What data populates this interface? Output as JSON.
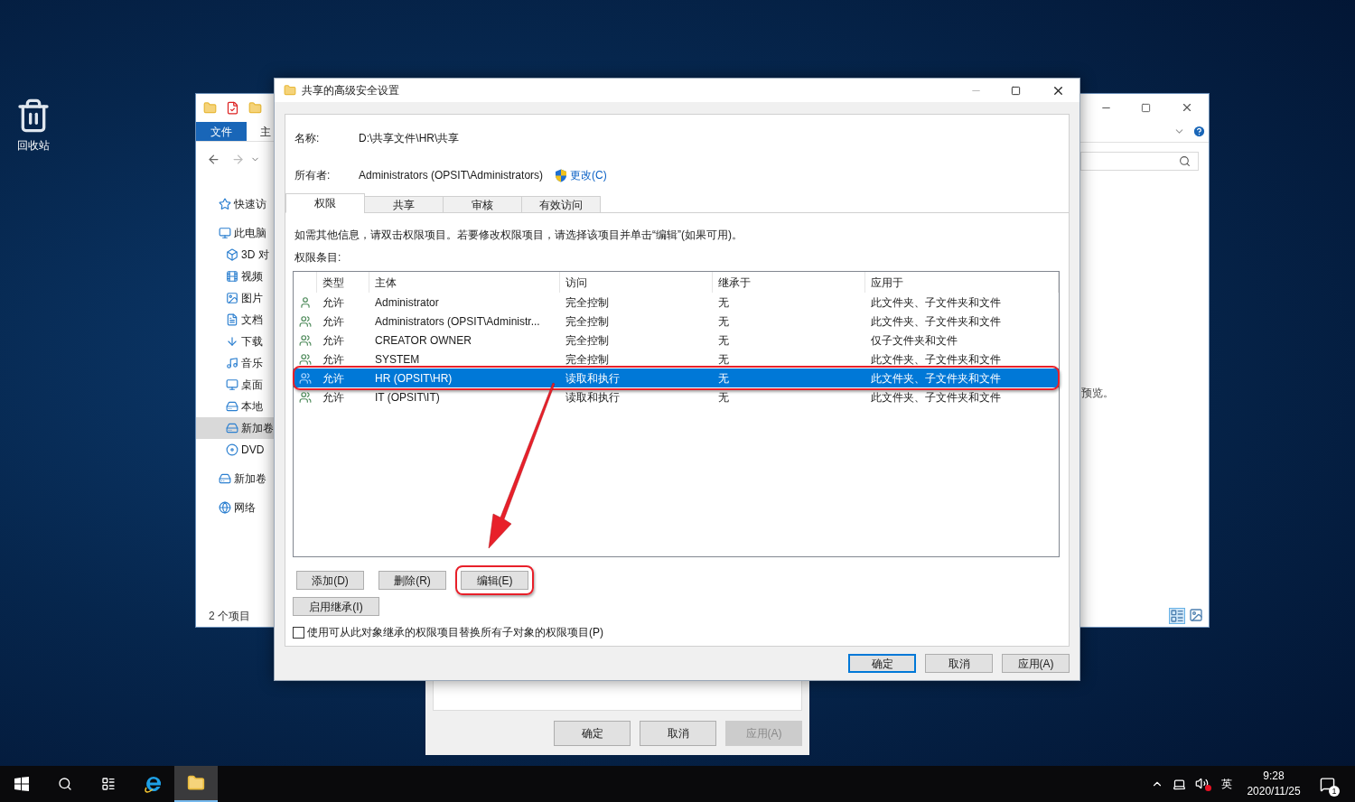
{
  "desktop": {
    "icons": [
      {
        "label": "回收站"
      }
    ]
  },
  "explorer": {
    "ribbon_tabs": [
      {
        "label": "文件",
        "selected": true
      },
      {
        "label": "主",
        "selected": false
      }
    ],
    "nav_items": [
      {
        "label": "快速访",
        "selected": false
      },
      {
        "label": "此电脑",
        "selected": false,
        "children": [
          {
            "label": "3D 对",
            "selected": false
          },
          {
            "label": "视频",
            "selected": false
          },
          {
            "label": "图片",
            "selected": false
          },
          {
            "label": "文档",
            "selected": false
          },
          {
            "label": "下载",
            "selected": false
          },
          {
            "label": "音乐",
            "selected": false
          },
          {
            "label": "桌面",
            "selected": false
          },
          {
            "label": "本地",
            "selected": false
          },
          {
            "label": "新加卷",
            "selected": true
          },
          {
            "label": "DVD",
            "selected": false
          }
        ]
      },
      {
        "label": "新加卷",
        "selected": false
      },
      {
        "label": "网络",
        "selected": false
      }
    ],
    "status": "2 个项目",
    "preview_text": "预览。"
  },
  "back_dialog": {
    "buttons": [
      {
        "label": "确定",
        "disabled": false
      },
      {
        "label": "取消",
        "disabled": false
      },
      {
        "label": "应用(A)",
        "disabled": true
      }
    ]
  },
  "dialog": {
    "title": "共享的高级安全设置",
    "name_label": "名称:",
    "name_value": "D:\\共享文件\\HR\\共享",
    "owner_label": "所有者:",
    "owner_value": "Administrators (OPSIT\\Administrators)",
    "change_link": "更改(C)",
    "tabs": [
      {
        "label": "权限",
        "selected": true
      },
      {
        "label": "共享",
        "selected": false
      },
      {
        "label": "审核",
        "selected": false
      },
      {
        "label": "有效访问",
        "selected": false
      }
    ],
    "info": "如需其他信息，请双击权限项目。若要修改权限项目，请选择该项目并单击“编辑”(如果可用)。",
    "entries_label": "权限条目:",
    "table": {
      "columns": [
        "类型",
        "主体",
        "访问",
        "继承于",
        "应用于"
      ],
      "rows": [
        {
          "kind": "user",
          "cells": [
            "允许",
            "Administrator",
            "完全控制",
            "无",
            "此文件夹、子文件夹和文件"
          ],
          "selected": false,
          "annotated": false
        },
        {
          "kind": "group",
          "cells": [
            "允许",
            "Administrators (OPSIT\\Administr...",
            "完全控制",
            "无",
            "此文件夹、子文件夹和文件"
          ],
          "selected": false,
          "annotated": false
        },
        {
          "kind": "group",
          "cells": [
            "允许",
            "CREATOR OWNER",
            "完全控制",
            "无",
            "仅子文件夹和文件"
          ],
          "selected": false,
          "annotated": false
        },
        {
          "kind": "group",
          "cells": [
            "允许",
            "SYSTEM",
            "完全控制",
            "无",
            "此文件夹、子文件夹和文件"
          ],
          "selected": false,
          "annotated": false
        },
        {
          "kind": "group",
          "cells": [
            "允许",
            "HR (OPSIT\\HR)",
            "读取和执行",
            "无",
            "此文件夹、子文件夹和文件"
          ],
          "selected": true,
          "annotated": true
        },
        {
          "kind": "group",
          "cells": [
            "允许",
            "IT (OPSIT\\IT)",
            "读取和执行",
            "无",
            "此文件夹、子文件夹和文件"
          ],
          "selected": false,
          "annotated": false
        }
      ]
    },
    "buttons": [
      {
        "label": "添加(D)",
        "annotated": false
      },
      {
        "label": "删除(R)",
        "annotated": false
      },
      {
        "label": "编辑(E)",
        "annotated": true
      }
    ],
    "inheritance_button": "启用继承(I)",
    "replace_checkbox": {
      "label": "使用可从此对象继承的权限项目替换所有子对象的权限项目(P)",
      "checked": false
    },
    "footer_buttons": [
      {
        "label": "确定",
        "default": true
      },
      {
        "label": "取消",
        "default": false
      },
      {
        "label": "应用(A)",
        "default": false
      }
    ]
  },
  "taskbar": {
    "ime": "英",
    "time": "9:28",
    "date": "2020/11/25",
    "notification_count": "1"
  }
}
